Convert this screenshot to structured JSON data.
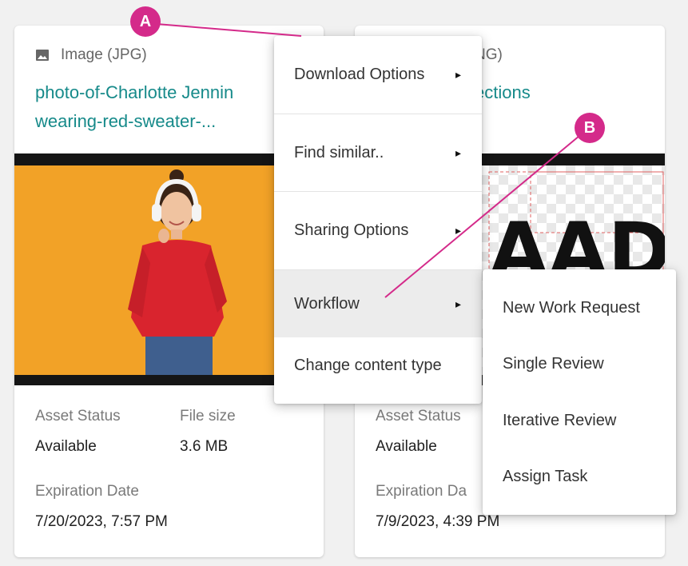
{
  "card1": {
    "type_label": "Image (JPG)",
    "title_line1": "photo-of-Charlotte Jennin",
    "title_line2": "wearing-red-sweater-...",
    "asset_status_label": "Asset Status",
    "asset_status_value": "Available",
    "file_size_label": "File size",
    "file_size_value": "3.6 MB",
    "expiration_label": "Expiration Date",
    "expiration_value": "7/20/2023, 7:57 PM"
  },
  "card2": {
    "type_label": "NG)",
    "title": "ections",
    "asset_status_label": "Asset Status",
    "asset_status_value": "Available",
    "expiration_label": "Expiration Da",
    "expiration_value": "7/9/2023, 4:39 PM",
    "preview_text": "AAD"
  },
  "context_menu": {
    "items": [
      {
        "label": "Download Options"
      },
      {
        "label": "Find similar.."
      },
      {
        "label": "Sharing Options"
      },
      {
        "label": "Workflow"
      },
      {
        "label": "Change content type"
      }
    ],
    "chevron": "▸"
  },
  "workflow_submenu": {
    "items": [
      {
        "label": "New Work Request"
      },
      {
        "label": "Single Review"
      },
      {
        "label": "Iterative Review"
      },
      {
        "label": "Assign Task"
      }
    ]
  },
  "callouts": {
    "a": "A",
    "b": "B"
  },
  "colors": {
    "accent_teal": "#168a8a",
    "callout_magenta": "#d42a8a",
    "photo_background": "#f2a227",
    "sweater_red": "#d9242e"
  }
}
